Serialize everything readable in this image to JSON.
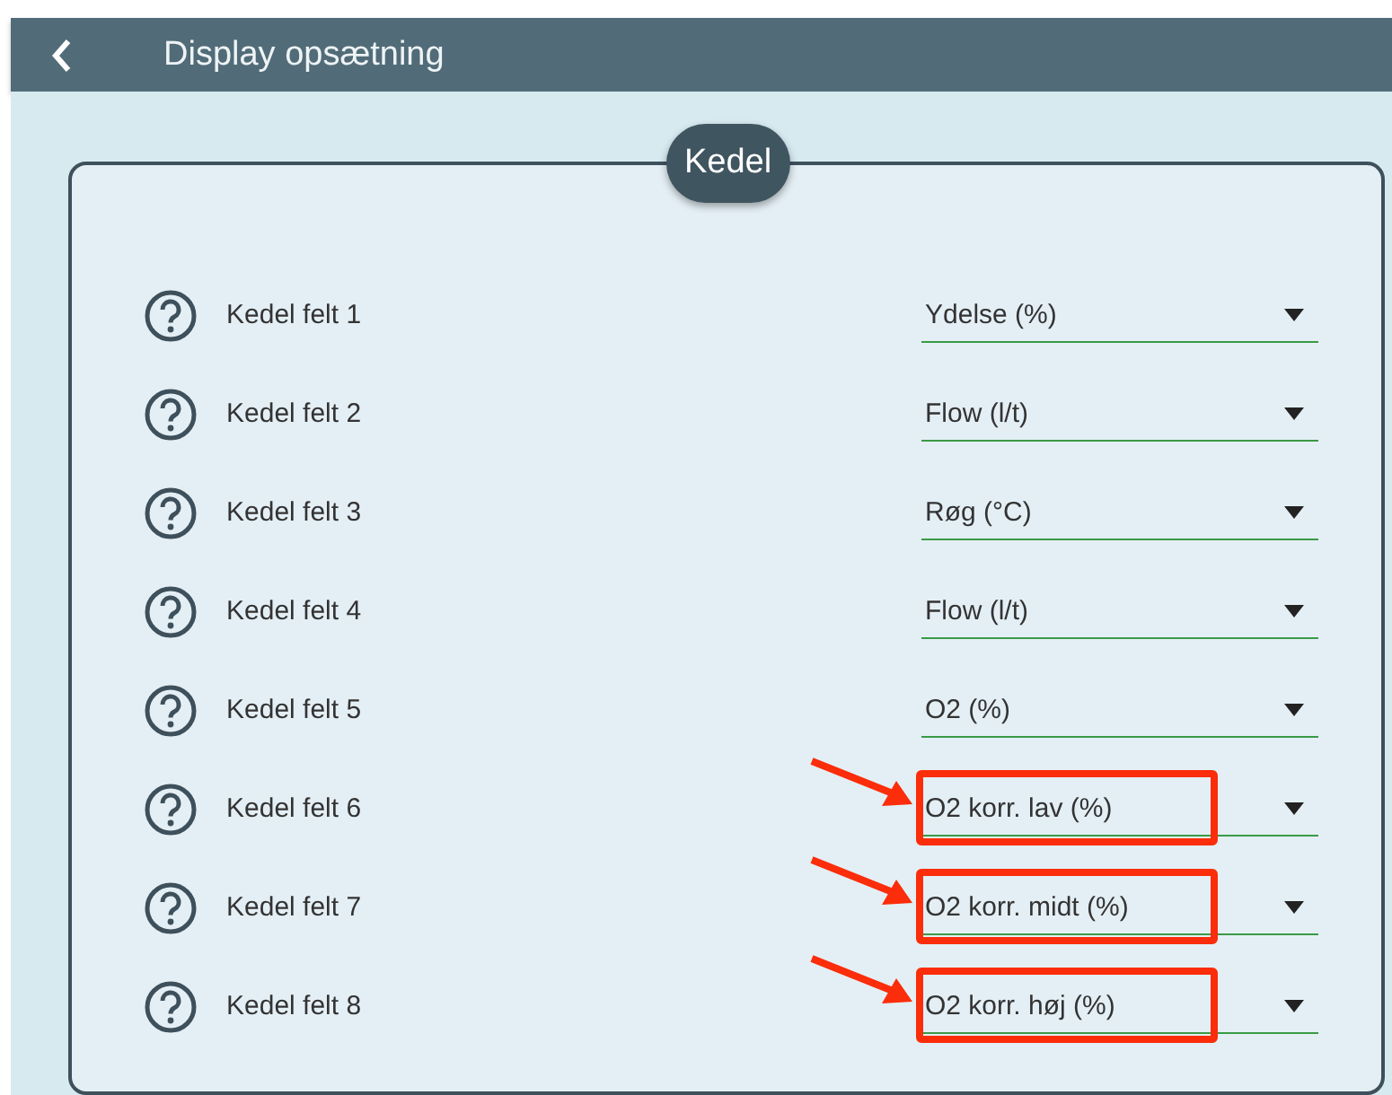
{
  "header": {
    "title": "Display opsætning"
  },
  "panel": {
    "title": "Kedel",
    "rows": [
      {
        "label": "Kedel felt 1",
        "value": "Ydelse (%)",
        "highlighted": false
      },
      {
        "label": "Kedel felt 2",
        "value": "Flow (l/t)",
        "highlighted": false
      },
      {
        "label": "Kedel felt 3",
        "value": "Røg (°C)",
        "highlighted": false
      },
      {
        "label": "Kedel felt 4",
        "value": "Flow (l/t)",
        "highlighted": false
      },
      {
        "label": "Kedel felt 5",
        "value": "O2 (%)",
        "highlighted": false
      },
      {
        "label": "Kedel felt 6",
        "value": "O2 korr. lav (%)",
        "highlighted": true
      },
      {
        "label": "Kedel felt 7",
        "value": "O2 korr. midt (%)",
        "highlighted": true
      },
      {
        "label": "Kedel felt 8",
        "value": "O2 korr. høj (%)",
        "highlighted": true
      }
    ]
  }
}
